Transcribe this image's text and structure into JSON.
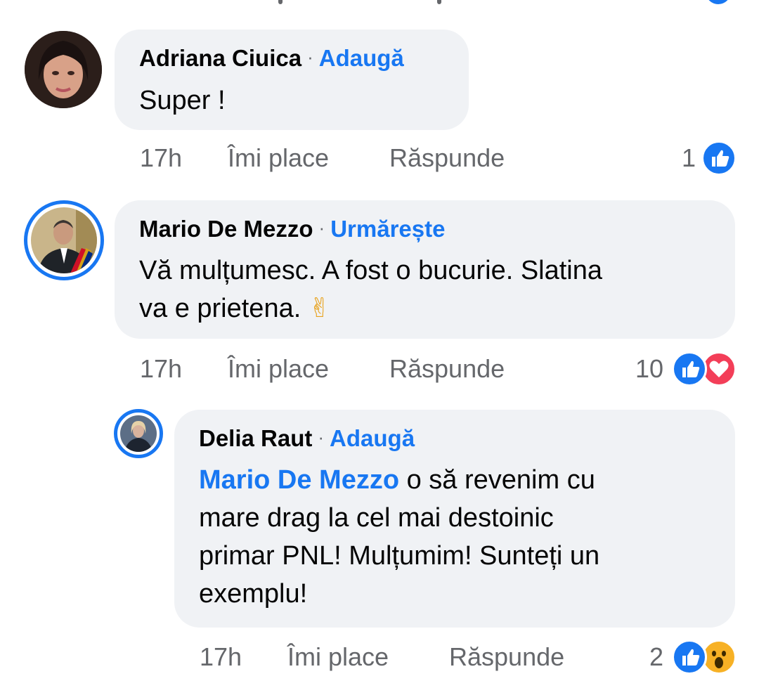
{
  "comments": [
    {
      "author": "Adriana Ciuica",
      "action": "Adaugă",
      "text": "Super !",
      "time": "17h",
      "like_label": "Îmi place",
      "reply_label": "Răspunde",
      "reaction_count": "1",
      "reactions": [
        "like-icon"
      ]
    },
    {
      "author": "Mario De Mezzo",
      "action": "Urmărește",
      "text_line1": "Vă mulțumesc. A fost o bucurie. Slatina",
      "text_line2": "va e prietena.",
      "emoji": "✌",
      "time": "17h",
      "like_label": "Îmi place",
      "reply_label": "Răspunde",
      "reaction_count": "10",
      "reactions": [
        "like-icon",
        "love-icon"
      ]
    },
    {
      "author": "Delia Raut",
      "action": "Adaugă",
      "mention": "Mario De Mezzo",
      "text_line1": " o să revenim cu",
      "text_line2": "mare drag la cel mai destoinic",
      "text_line3": "primar PNL! Mulțumim! Sunteți un",
      "text_line4": "exemplu!",
      "time": "17h",
      "like_label": "Îmi place",
      "reply_label": "Răspunde",
      "reaction_count": "2",
      "reactions": [
        "like-icon",
        "wow-icon"
      ]
    }
  ],
  "colors": {
    "accent": "#1877f2",
    "bubble": "#f0f2f5",
    "meta": "#65676b",
    "love": "#f33e58",
    "wow": "#f7b125"
  }
}
